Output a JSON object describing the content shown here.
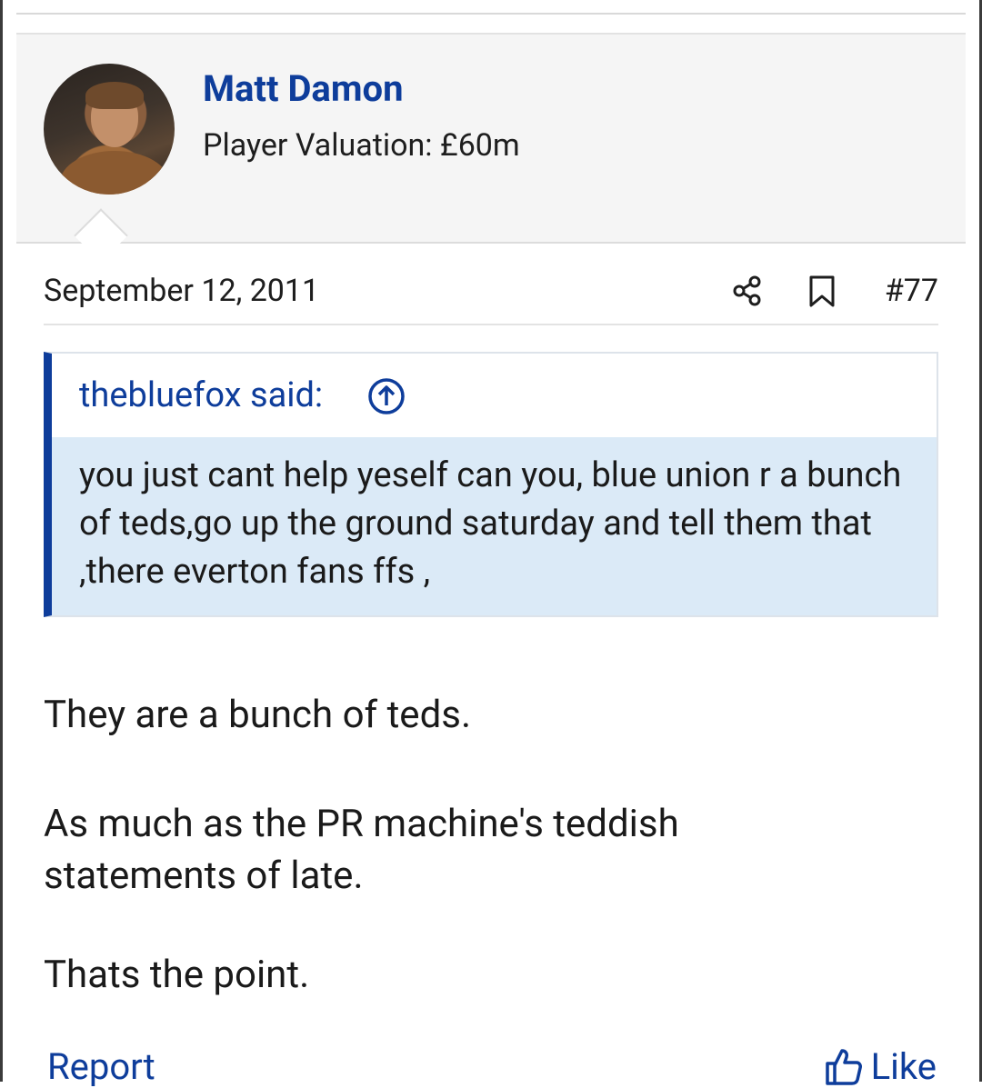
{
  "user": {
    "name": "Matt Damon",
    "title": "Player Valuation: £60m"
  },
  "post": {
    "date": "September 12, 2011",
    "number": "#77"
  },
  "quote": {
    "attribution": "thebluefox said:",
    "text": "you just cant help yeself can you, blue union r a bunch of teds,go up the ground saturday and tell them that ,there everton fans ffs ,"
  },
  "message": {
    "paragraphs": [
      "They are a bunch of teds.",
      "As much as the PR machine's teddish statements of late.",
      "Thats the point."
    ]
  },
  "actions": {
    "report_label": "Report",
    "like_label": "Like"
  },
  "colors": {
    "link": "#0e3d9b",
    "quote_background": "#dbeaf7",
    "header_background": "#f5f5f5"
  },
  "icons": [
    "share-icon",
    "bookmark-icon",
    "arrow-up-circle-icon",
    "thumbs-up-icon"
  ]
}
